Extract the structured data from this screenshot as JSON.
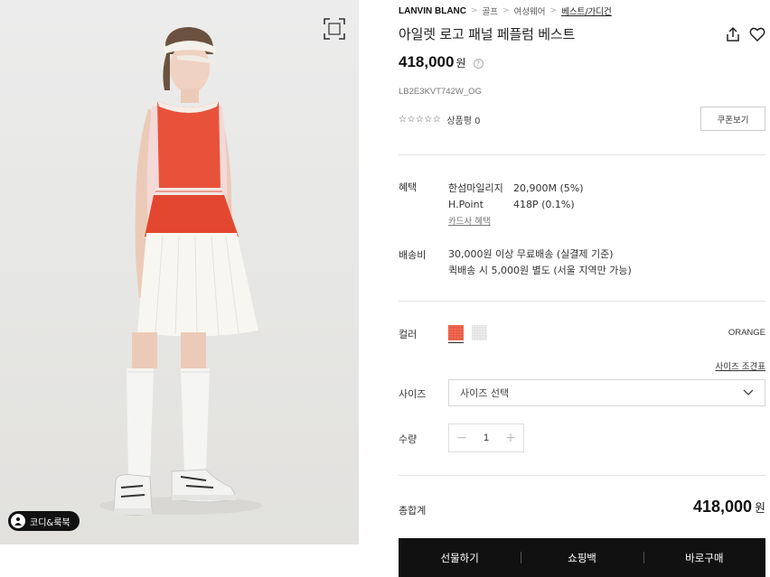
{
  "breadcrumb": {
    "brand": "LANVIN BLANC",
    "items": [
      "골프",
      "여성웨어",
      "베스트/가디건"
    ]
  },
  "product": {
    "title": "아일렛 로고 패널 페플럼 베스트",
    "price": "418,000",
    "price_unit": "원",
    "code": "LB2E3KVT742W_OG",
    "rating_stars": "☆☆☆☆☆",
    "review_label": "상품평 0",
    "coupon_button": "쿠폰보기"
  },
  "photo": {
    "look_badge": "코디&룩북",
    "background_color": "#e9e9e8"
  },
  "benefits": {
    "label": "혜택",
    "rows": [
      {
        "name": "한섬마일리지",
        "value": "20,900M (5%)"
      },
      {
        "name": "H.Point",
        "value": "418P (0.1%)"
      }
    ],
    "card_link": "카드사 혜택"
  },
  "shipping": {
    "label": "배송비",
    "line1": "30,000원 이상 무료배송 (실결제 기준)",
    "line2": "퀵배송 시 5,000원 별도 (서울 지역만 가능)"
  },
  "color": {
    "label": "컬러",
    "selected": "ORANGE",
    "swatches": [
      "#e8523a",
      "#dcdcdc"
    ]
  },
  "size": {
    "guide_link": "사이즈 조견표",
    "label": "사이즈",
    "placeholder": "사이즈 선택"
  },
  "quantity": {
    "label": "수량",
    "value": "1"
  },
  "total": {
    "label": "총합계",
    "price": "418,000",
    "unit": "원"
  },
  "actions": {
    "gift": "선물하기",
    "cart": "쇼핑백",
    "buy": "바로구매"
  }
}
